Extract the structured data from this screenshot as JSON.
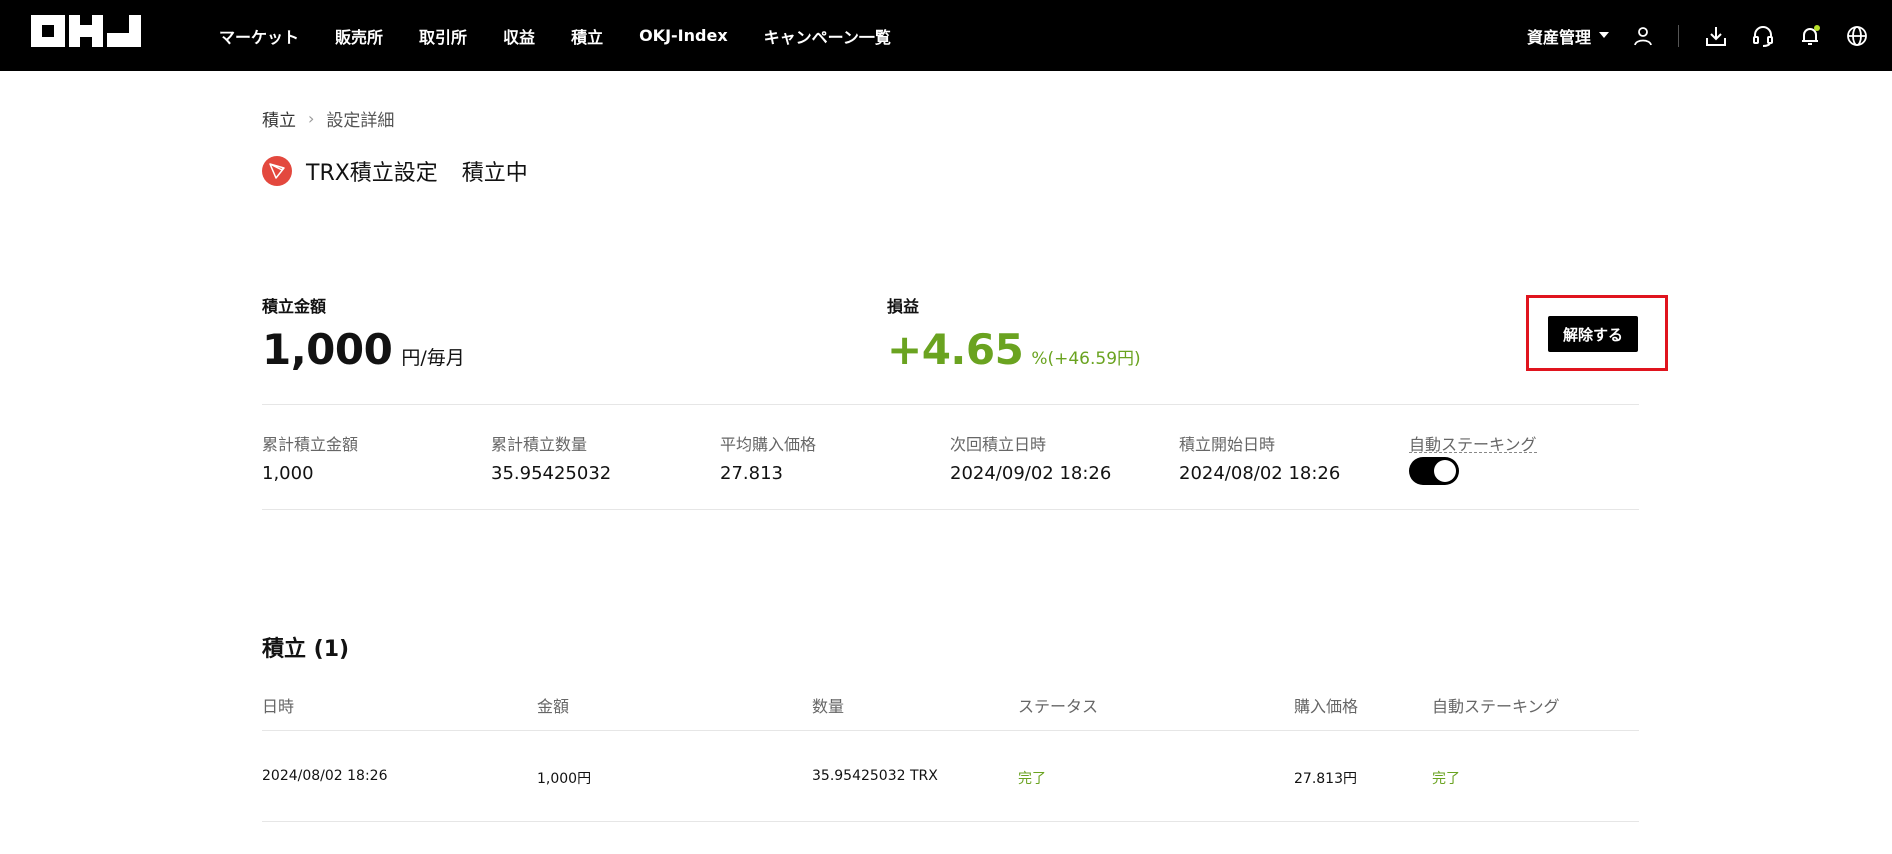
{
  "header": {
    "logo_text": "OKJ",
    "nav": [
      "マーケット",
      "販売所",
      "取引所",
      "収益",
      "積立",
      "OKJ-Index",
      "キャンペーン一覧"
    ],
    "asset_menu": "資産管理",
    "icons": [
      "user-icon",
      "download-icon",
      "headset-icon",
      "bell-icon",
      "globe-icon"
    ]
  },
  "breadcrumb": {
    "parent": "積立",
    "current": "設定詳細"
  },
  "title": {
    "coin": "TRX",
    "text": "TRX積立設定",
    "status": "積立中"
  },
  "summary": {
    "amount_label": "積立金額",
    "amount_value": "1,000",
    "amount_unit": "円/毎月",
    "pnl_label": "損益",
    "pnl_value": "+4.65",
    "pnl_detail": "%(+46.59円)",
    "cancel_button": "解除する"
  },
  "stats": [
    {
      "label": "累計積立金額",
      "value": "1,000"
    },
    {
      "label": "累計積立数量",
      "value": "35.95425032"
    },
    {
      "label": "平均購入価格",
      "value": "27.813"
    },
    {
      "label": "次回積立日時",
      "value": "2024/09/02 18:26"
    },
    {
      "label": "積立開始日時",
      "value": "2024/08/02 18:26"
    }
  ],
  "auto_staking": {
    "label": "自動ステーキング",
    "enabled": true
  },
  "history": {
    "title": "積立 (1)",
    "columns": [
      "日時",
      "金額",
      "数量",
      "ステータス",
      "購入価格",
      "自動ステーキング"
    ],
    "rows": [
      [
        "2024/08/02 18:26",
        "1,000円",
        "35.95425032 TRX",
        "完了",
        "27.813円",
        "完了"
      ]
    ]
  },
  "colors": {
    "positive": "#6aa320",
    "highlight": "#e0141e",
    "trx": "#e3483e"
  }
}
